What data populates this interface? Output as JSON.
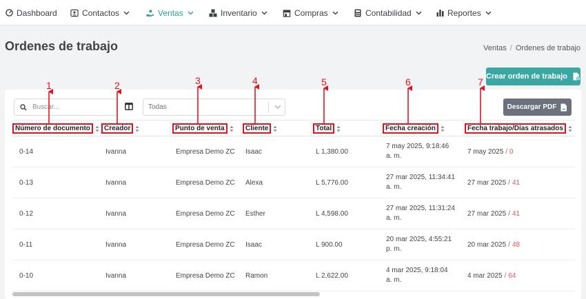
{
  "nav": {
    "items": [
      {
        "label": "Dashboard",
        "icon": "dashboard-icon"
      },
      {
        "label": "Contactos",
        "icon": "contacts-icon"
      },
      {
        "label": "Ventas",
        "icon": "sales-hand-icon"
      },
      {
        "label": "Inventario",
        "icon": "inventory-icon"
      },
      {
        "label": "Compras",
        "icon": "store-icon"
      },
      {
        "label": "Contabilidad",
        "icon": "calculator-icon"
      },
      {
        "label": "Reportes",
        "icon": "bar-chart-icon"
      }
    ],
    "active": "Ventas",
    "accent_color": "#2aa19b"
  },
  "page": {
    "title": "Ordenes de trabajo",
    "breadcrumb": [
      "Ventas",
      "Ordenes de trabajo"
    ]
  },
  "actions": {
    "create_label": "Crear orden de trabajo",
    "create_color": "#3aa7a3",
    "pdf_label": "Descargar PDF",
    "pdf_color": "#6b727c"
  },
  "filters": {
    "search_placeholder": "Buscar...",
    "select_value": "Todas"
  },
  "table": {
    "columns": [
      "Número de documento",
      "Creador",
      "Punto de venta",
      "Cliente",
      "Total",
      "Fecha creación",
      "Fecha trabajo/Días atrasados"
    ],
    "rows": [
      {
        "doc": "0-14",
        "creator": "Ivanna",
        "pos": "Empresa Demo ZC",
        "client": "Isaac",
        "total": "L 1,380.00",
        "created_1": "7 may 2025, 9:18:46",
        "created_2": "a. m.",
        "work_date": "7 may 2025",
        "days_late": "0"
      },
      {
        "doc": "0-13",
        "creator": "Ivanna",
        "pos": "Empresa Demo ZC",
        "client": "Alexa",
        "total": "L 5,776.00",
        "created_1": "27 mar 2025, 11:34:41",
        "created_2": "a. m.",
        "work_date": "27 mar 2025",
        "days_late": "41"
      },
      {
        "doc": "0-12",
        "creator": "Ivanna",
        "pos": "Empresa Demo ZC",
        "client": "Esther",
        "total": "L 4,598.00",
        "created_1": "27 mar 2025, 11:31:24",
        "created_2": "a. m.",
        "work_date": "27 mar 2025",
        "days_late": "41"
      },
      {
        "doc": "0-11",
        "creator": "Ivanna",
        "pos": "Empresa Demo ZC",
        "client": "Isaac",
        "total": "L 900.00",
        "created_1": "20 mar 2025, 4:55:21",
        "created_2": "p. m.",
        "work_date": "20 mar 2025",
        "days_late": "48"
      },
      {
        "doc": "0-10",
        "creator": "Ivanna",
        "pos": "Empresa Demo ZC",
        "client": "Ramon",
        "total": "L 2,622.00",
        "created_1": "4 mar 2025, 9:18:04",
        "created_2": "a. m.",
        "work_date": "4 mar 2025",
        "days_late": "64"
      }
    ],
    "late_color": "#e2534f"
  },
  "annotations": {
    "labels": [
      "1",
      "2",
      "3",
      "4",
      "5",
      "6",
      "7"
    ],
    "color": "#e8101c"
  }
}
